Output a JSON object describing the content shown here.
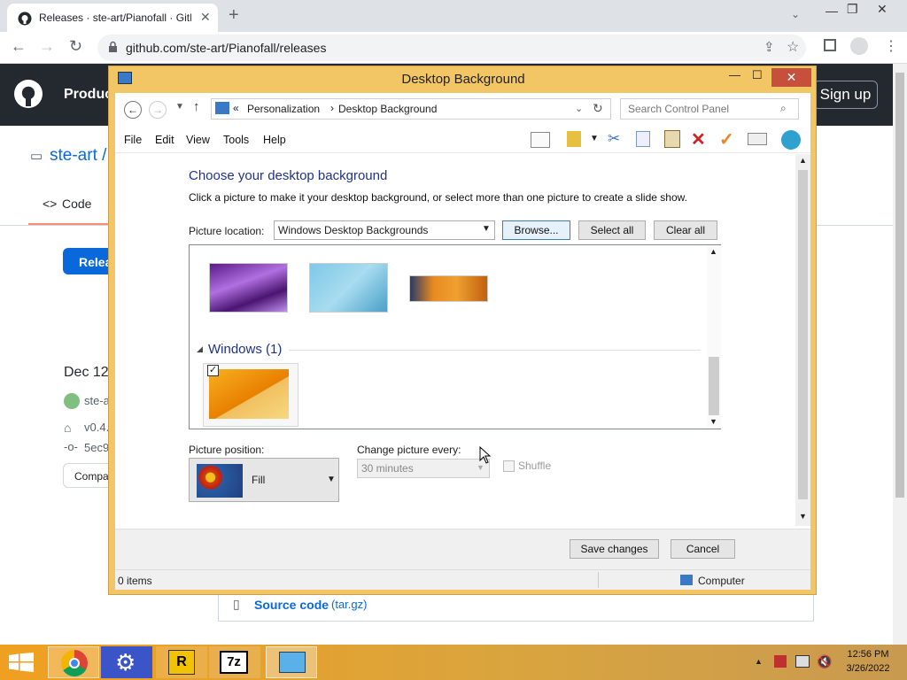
{
  "browser": {
    "tab_title": "Releases · ste-art/Pianofall · GitH",
    "url": "github.com/ste-art/Pianofall/releases"
  },
  "github": {
    "product_label": "Produc",
    "signin_label": "Sign up",
    "repo_label": "ste-art /",
    "code_tab": "Code",
    "releases_button": "Relea",
    "release_date": "Dec 12,",
    "author": "ste-a",
    "tag": "v0.4.",
    "commit": "5ec9",
    "compare_button": "Compa",
    "source_code": "Source code",
    "source_code_format": "(tar.gz)"
  },
  "dialog": {
    "title": "Desktop Background",
    "breadcrumb": {
      "prefix": "«",
      "item1": "Personalization",
      "sep": "›",
      "item2": "Desktop Background"
    },
    "search_placeholder": "Search Control Panel",
    "menu": [
      "File",
      "Edit",
      "View",
      "Tools",
      "Help"
    ],
    "heading": "Choose your desktop background",
    "subtext": "Click a picture to make it your desktop background, or select more than one picture to create a slide show.",
    "picture_location_label": "Picture location:",
    "picture_location_value": "Windows Desktop Backgrounds",
    "browse_button": "Browse...",
    "select_all_button": "Select all",
    "clear_all_button": "Clear all",
    "group_windows_label": "Windows (1)",
    "picture_position_label": "Picture position:",
    "picture_position_value": "Fill",
    "change_picture_label": "Change picture every:",
    "change_picture_value": "30 minutes",
    "shuffle_label": "Shuffle",
    "save_button": "Save changes",
    "cancel_button": "Cancel",
    "status_items": "0 items",
    "status_location": "Computer"
  },
  "taskbar": {
    "time": "12:56 PM",
    "date": "3/26/2022",
    "start_label": "start"
  },
  "colors": {
    "dialog_frame": "#f3c665",
    "close_button": "#c7503c",
    "heading": "#1e3287",
    "github_header": "#24292f"
  }
}
